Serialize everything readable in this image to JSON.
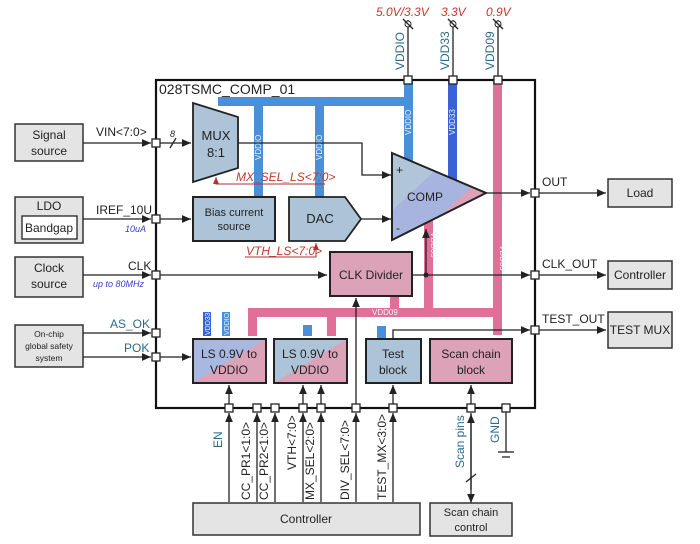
{
  "title": "028TSMC_COMP_01",
  "supplies": [
    {
      "name": "VDDIO",
      "voltage": "5.0V/3.3V"
    },
    {
      "name": "VDD33",
      "voltage": "3.3V"
    },
    {
      "name": "VDD09",
      "voltage": "0.9V"
    }
  ],
  "rails": {
    "vddio": "VDDIO",
    "vdd33": "VDD33",
    "vdd09": "VDD09"
  },
  "colors": {
    "vddio": "#4a90d9",
    "vdd33": "#3a62d6",
    "vdd09": "#e07098",
    "block_blue": "#adc4d8",
    "block_pink": "#dca2b8",
    "external": "#e4e4e4",
    "annotation_red": "#c0392b"
  },
  "external_left": {
    "signal_source": [
      "Signal",
      "source"
    ],
    "ldo": "LDO",
    "bandgap": "Bandgap",
    "clock_source": [
      "Clock",
      "source"
    ],
    "safety": [
      "On-chip",
      "global safety",
      "system"
    ]
  },
  "left_pins": {
    "vin": "VIN<7:0>",
    "bus_width": "8",
    "iref": "IREF_10U",
    "iref_note": "10uA",
    "clk": "CLK",
    "clk_note": "up to 80MHz",
    "as_ok": "AS_OK",
    "pok": "POK"
  },
  "blocks": {
    "mux": [
      "MUX",
      "8:1"
    ],
    "bias": [
      "Bias current",
      "source"
    ],
    "dac": "DAC",
    "comp": "COMP",
    "comp_plus": "+",
    "comp_minus": "-",
    "clk_divider": "CLK Divider",
    "ls1": [
      "LS 0.9V to",
      "VDDIO"
    ],
    "ls2": [
      "LS 0.9V to",
      "VDDIO"
    ],
    "test": [
      "Test",
      "block"
    ],
    "scan": [
      "Scan chain",
      "block"
    ]
  },
  "internal_signals": {
    "mx_sel_ls": "MX_SEL_LS<7:0>",
    "vth_ls": "VTH_LS<7:0>"
  },
  "right_pins": {
    "out": "OUT",
    "clk_out": "CLK_OUT",
    "test_out": "TEST_OUT"
  },
  "external_right": {
    "load": "Load",
    "controller": "Controller",
    "test_mux": "TEST MUX"
  },
  "bottom_pins": [
    "EN",
    "CC_PR1<1:0>",
    "CC_PR2<1:0>",
    "VTH<7:0>",
    "MX_SEL<2:0>",
    "DIV_SEL<7:0>",
    "TEST_MX<3:0>"
  ],
  "scan_pins": "Scan pins",
  "gnd": "GND",
  "external_bottom": {
    "controller": "Controller",
    "scan_control": [
      "Scan chain",
      "control"
    ]
  }
}
